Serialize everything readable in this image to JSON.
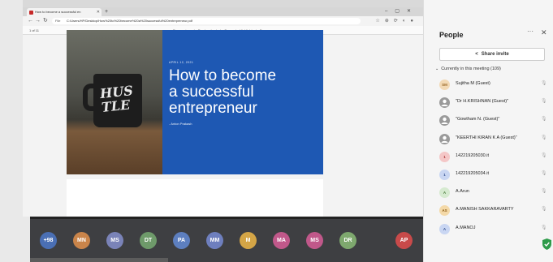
{
  "browser": {
    "tab_title": "How to become a successful en",
    "url": "C:/Users/HP/Desktop/How%20to%20become%20a%20successful%20entrepreneur.pdf",
    "url_scheme": "File",
    "page_indicator": "1 of 11",
    "pdf_tools": "Page view  |  Read aloud  |  Draw  |  Highlight  |  Erase"
  },
  "slide": {
    "date": "APRIL 12, 2021",
    "title_line1": "How to become",
    "title_line2": "a successful",
    "title_line3": "entrepreneur",
    "author": "- Anton Prakash",
    "mug_text_1": "HUS",
    "mug_text_2": "TLE"
  },
  "participants_bar": [
    {
      "initials": "+98",
      "color": "#4a6fb4"
    },
    {
      "initials": "MN",
      "color": "#c9844a"
    },
    {
      "initials": "MS",
      "color": "#7a83b8"
    },
    {
      "initials": "DT",
      "color": "#6e9a6a"
    },
    {
      "initials": "PA",
      "color": "#5d7fbf"
    },
    {
      "initials": "MM",
      "color": "#6e7fbe"
    },
    {
      "initials": "M",
      "color": "#d4a546"
    },
    {
      "initials": "MA",
      "color": "#c0588a"
    },
    {
      "initials": "MS",
      "color": "#c0588a"
    },
    {
      "initials": "DR",
      "color": "#7ea86e"
    },
    {
      "initials": "AP",
      "color": "#c84a4a"
    }
  ],
  "panel": {
    "title": "People",
    "more": "···",
    "close": "✕",
    "share_label": "Share invite",
    "section": "Currently in this meeting (109)",
    "people": [
      {
        "initials": "SM",
        "name": "Sujitha M (Guest)",
        "bg": "#f2d9b5",
        "fg": "#9a6a2a"
      },
      {
        "initials": "",
        "name": "\"Dr H.KRISHNAN (Guest)\"",
        "bg": "#9a9a9a",
        "fg": "#ffffff"
      },
      {
        "initials": "",
        "name": "\"Gowtham N. (Guest)\"",
        "bg": "#9a9a9a",
        "fg": "#ffffff"
      },
      {
        "initials": "",
        "name": "\"KEERTHI KIRAN K A (Guest)\"",
        "bg": "#9a9a9a",
        "fg": "#ffffff"
      },
      {
        "initials": "1",
        "name": "142219205030.it",
        "bg": "#f4c7c7",
        "fg": "#a33"
      },
      {
        "initials": "1",
        "name": "142219205034.it",
        "bg": "#c9d6f2",
        "fg": "#35508f"
      },
      {
        "initials": "A",
        "name": "A.Arun",
        "bg": "#d6ead0",
        "fg": "#4a7a3a"
      },
      {
        "initials": "AS",
        "name": "A.MANISH SAKKARAVARTY",
        "bg": "#f4d9a8",
        "fg": "#8a5a14"
      },
      {
        "initials": "A",
        "name": "A.MANOJ",
        "bg": "#c9d6f2",
        "fg": "#35508f"
      }
    ]
  }
}
